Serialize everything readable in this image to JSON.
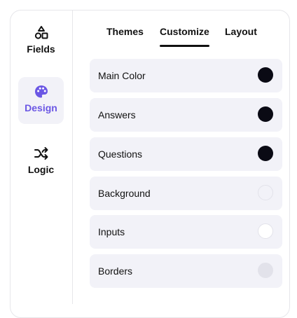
{
  "sidebar": {
    "items": [
      {
        "label": "Fields",
        "icon": "shapes-icon",
        "active": false
      },
      {
        "label": "Design",
        "icon": "palette-icon",
        "active": true
      },
      {
        "label": "Logic",
        "icon": "shuffle-icon",
        "active": false
      }
    ],
    "active_color": "#6b57e4"
  },
  "tabs": {
    "items": [
      "Themes",
      "Customize",
      "Layout"
    ],
    "active": "Customize"
  },
  "color_rows": [
    {
      "label": "Main Color",
      "color": "#0a0a14"
    },
    {
      "label": "Answers",
      "color": "#0a0a14"
    },
    {
      "label": "Questions",
      "color": "#0a0a14"
    },
    {
      "label": "Background",
      "color": "#f2f2f8"
    },
    {
      "label": "Inputs",
      "color": "#ffffff"
    },
    {
      "label": "Borders",
      "color": "#e2e2ea"
    }
  ]
}
